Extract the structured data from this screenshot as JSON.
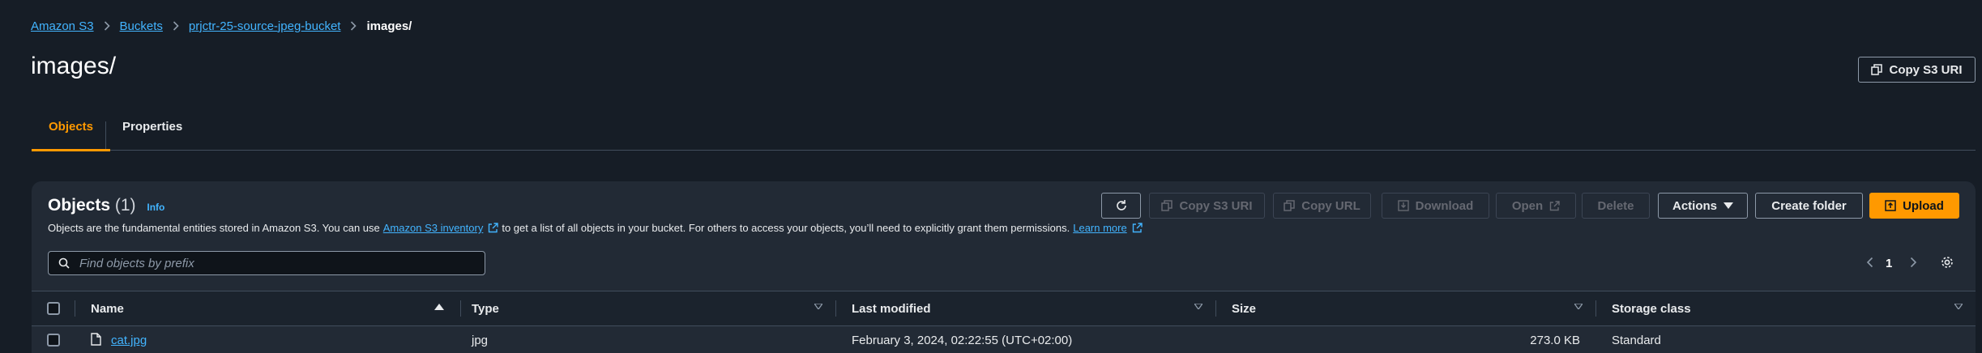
{
  "breadcrumb": {
    "items": [
      "Amazon S3",
      "Buckets",
      "prjctr-25-source-jpeg-bucket"
    ],
    "current": "images/"
  },
  "page": {
    "title": "images/",
    "copy_s3_uri": "Copy S3 URI"
  },
  "tabs": [
    {
      "label": "Objects",
      "active": true
    },
    {
      "label": "Properties",
      "active": false
    }
  ],
  "objects_panel": {
    "title": "Objects",
    "count": "(1)",
    "info": "Info",
    "description": {
      "part1": "Objects are the fundamental entities stored in Amazon S3. You can use",
      "link1": "Amazon S3 inventory",
      "part2": "to get a list of all objects in your bucket. For others to access your objects, you’ll need to explicitly grant them permissions.",
      "link2": "Learn more"
    },
    "actions": {
      "copy_s3_uri": "Copy S3 URI",
      "copy_url": "Copy URL",
      "download": "Download",
      "open": "Open",
      "delete": "Delete",
      "actions": "Actions",
      "create_folder": "Create folder",
      "upload": "Upload"
    },
    "search": {
      "placeholder": "Find objects by prefix",
      "value": ""
    },
    "pagination": {
      "current_page": "1"
    },
    "columns": [
      "Name",
      "Type",
      "Last modified",
      "Size",
      "Storage class"
    ],
    "rows": [
      {
        "name": "cat.jpg",
        "type": "jpg",
        "last_modified": "February 3, 2024, 02:22:55 (UTC+02:00)",
        "size": "273.0 KB",
        "storage_class": "Standard"
      }
    ]
  },
  "colors": {
    "background": "#161d26",
    "panel": "#222a35",
    "accent": "#ff9900",
    "link": "#42b4ff"
  },
  "icons": [
    "chevron-right-icon",
    "copy-icon",
    "refresh-icon",
    "download-icon",
    "external-link-icon",
    "caret-down-icon",
    "upload-icon",
    "search-icon",
    "chevron-left-icon",
    "gear-icon",
    "sort-asc-icon",
    "sort-desc-icon",
    "file-icon"
  ]
}
